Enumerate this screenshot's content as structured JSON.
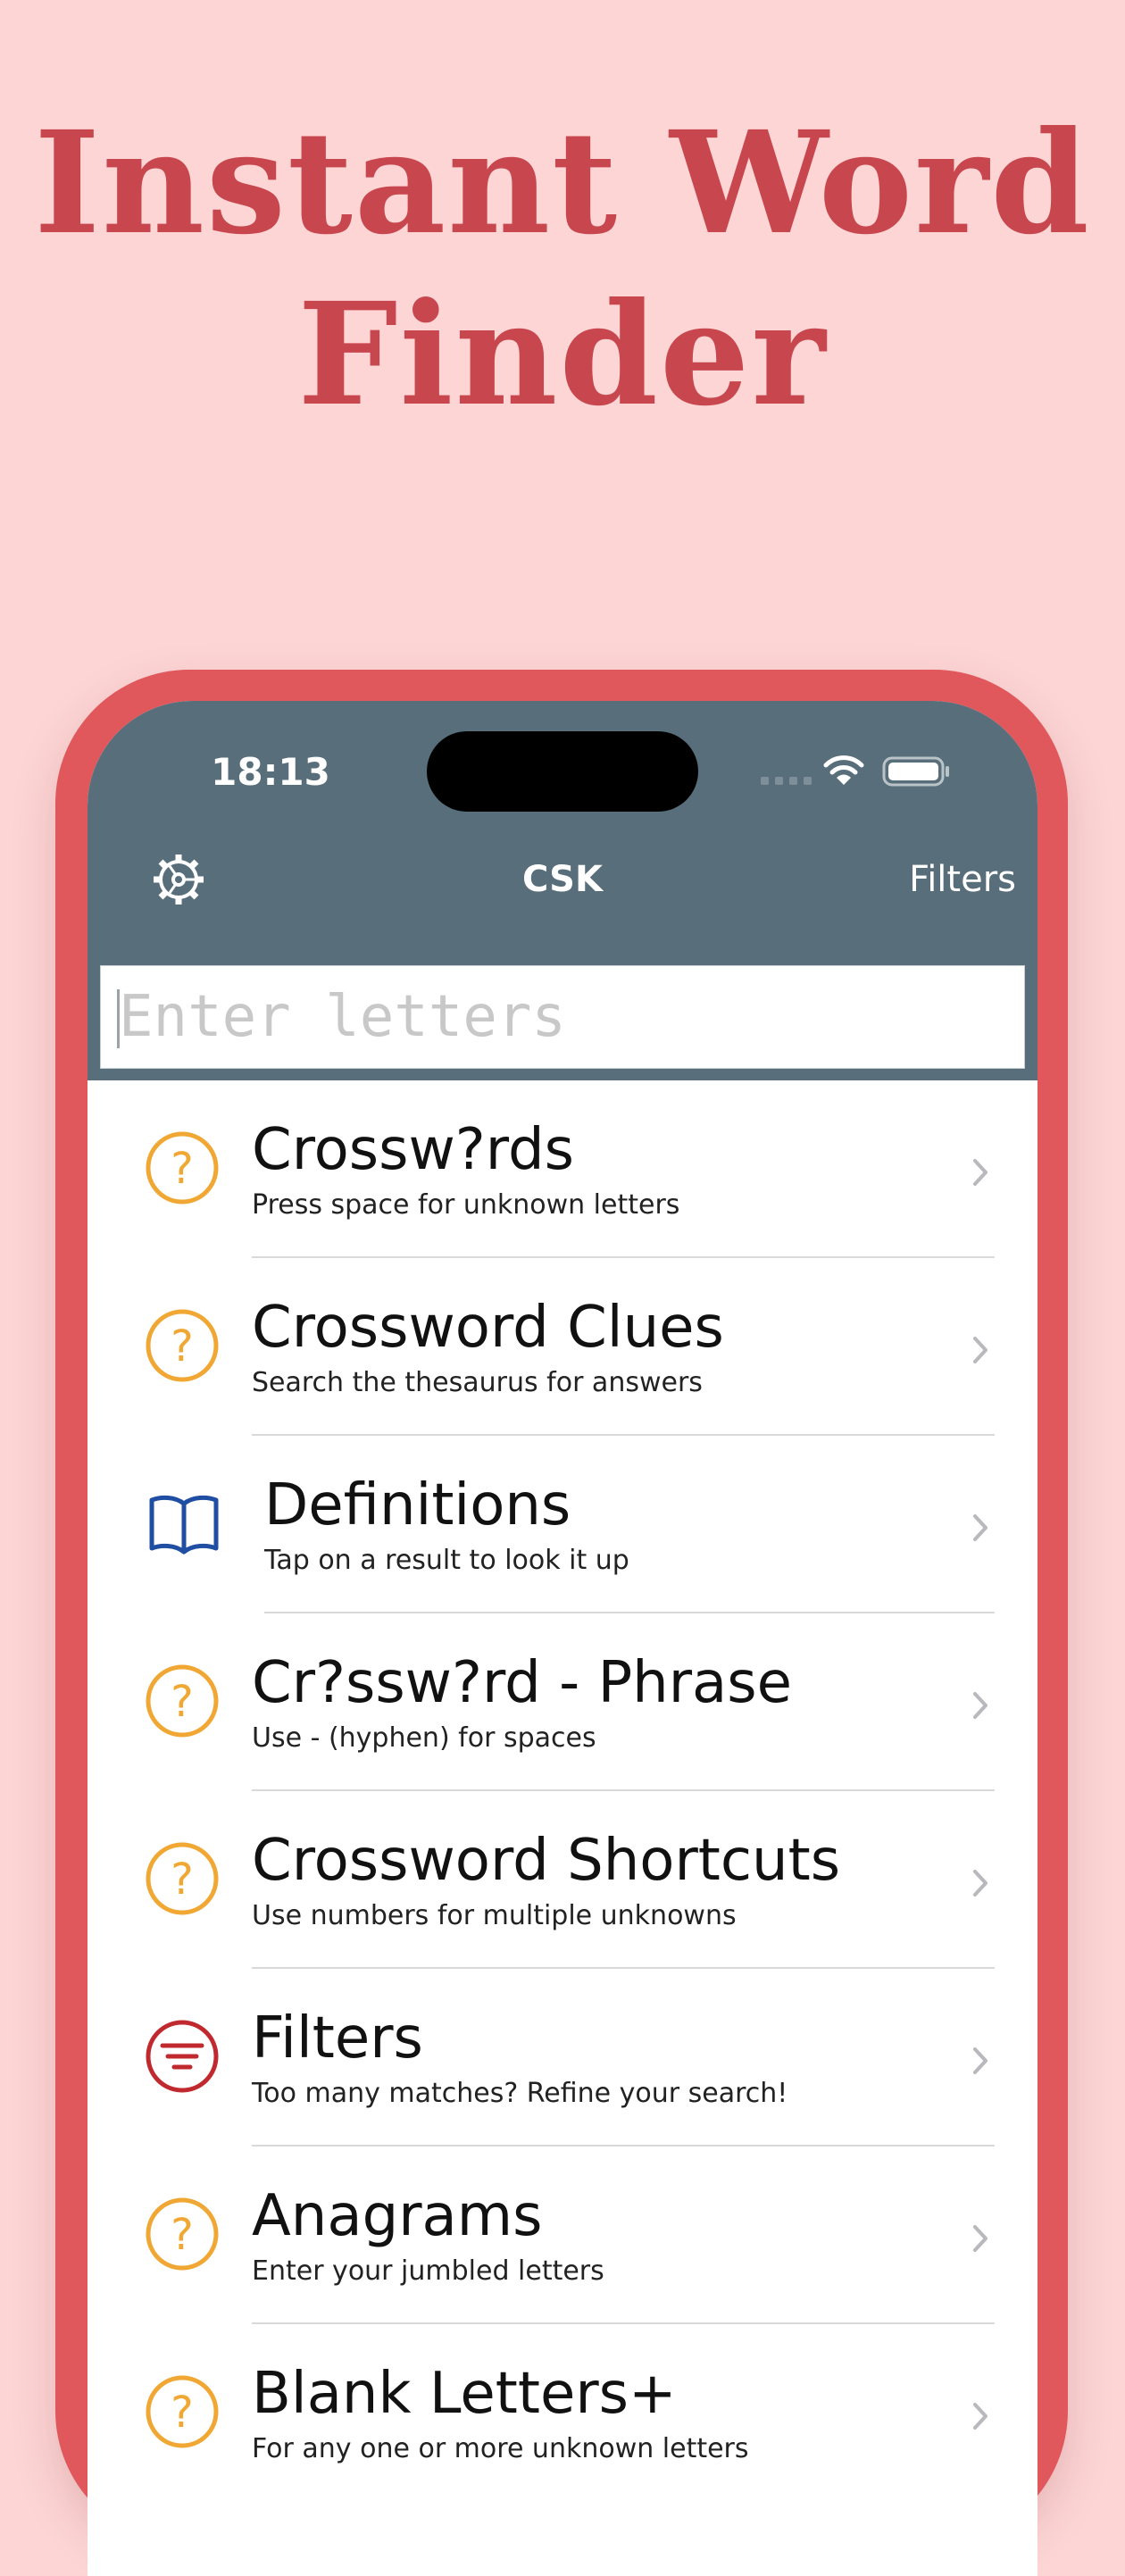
{
  "headline": {
    "line1": "Instant Word",
    "line2": "Finder"
  },
  "status_bar": {
    "time": "18:13"
  },
  "nav": {
    "title": "CSK",
    "filters_label": "Filters"
  },
  "search": {
    "placeholder": "Enter letters",
    "value": ""
  },
  "colors": {
    "background": "#fdd5d5",
    "headline": "#c8464e",
    "phone_frame": "#e0575c",
    "topbar": "#586f7b",
    "question_icon": "#f0a733",
    "book_icon": "#1f4ea3",
    "filter_icon": "#c0292e"
  },
  "menu": [
    {
      "icon": "question-icon",
      "title": "Crossw?rds",
      "subtitle": "Press space for unknown letters"
    },
    {
      "icon": "question-icon",
      "title": "Crossword Clues",
      "subtitle": "Search the thesaurus for answers"
    },
    {
      "icon": "book-icon",
      "title": "Definitions",
      "subtitle": "Tap on a result to look it up"
    },
    {
      "icon": "question-icon",
      "title": "Cr?ssw?rd - Phrase",
      "subtitle": "Use - (hyphen) for spaces"
    },
    {
      "icon": "question-icon",
      "title": "Crossword Shortcuts",
      "subtitle": "Use numbers for multiple unknowns"
    },
    {
      "icon": "filter-icon",
      "title": "Filters",
      "subtitle": "Too many matches? Refine your search!"
    },
    {
      "icon": "question-icon",
      "title": "Anagrams",
      "subtitle": "Enter your jumbled letters"
    },
    {
      "icon": "question-icon",
      "title": "Blank Letters+",
      "subtitle": "For any one or more unknown letters"
    }
  ]
}
